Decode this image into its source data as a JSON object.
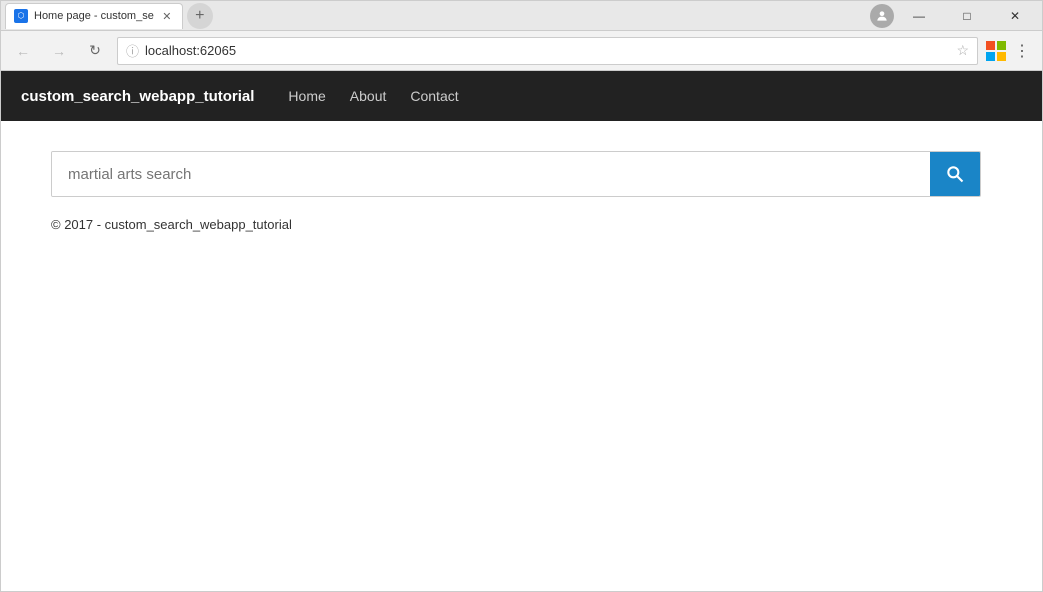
{
  "browser": {
    "tab_title": "Home page - custom_se",
    "url": "localhost:62065",
    "new_tab_symbol": "+",
    "minimize_symbol": "—",
    "maximize_symbol": "□",
    "close_symbol": "✕"
  },
  "navbar": {
    "brand": "custom_search_webapp_tutorial",
    "links": [
      {
        "label": "Home"
      },
      {
        "label": "About"
      },
      {
        "label": "Contact"
      }
    ]
  },
  "search": {
    "placeholder": "martial arts search",
    "search_icon": "🔍"
  },
  "footer": {
    "text": "© 2017 - custom_search_webapp_tutorial"
  }
}
